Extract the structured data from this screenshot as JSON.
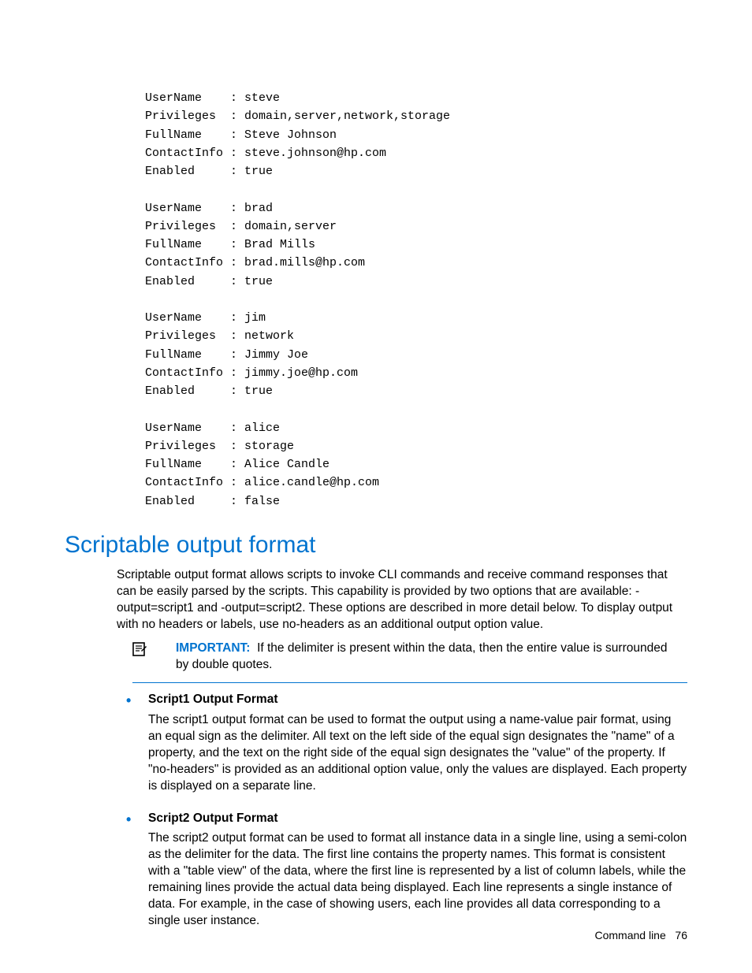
{
  "users": [
    {
      "UserName": "steve",
      "Privileges": "domain,server,network,storage",
      "FullName": "Steve Johnson",
      "ContactInfo": "steve.johnson@hp.com",
      "Enabled": "true"
    },
    {
      "UserName": "brad",
      "Privileges": "domain,server",
      "FullName": "Brad Mills",
      "ContactInfo": "brad.mills@hp.com",
      "Enabled": "true"
    },
    {
      "UserName": "jim",
      "Privileges": "network",
      "FullName": "Jimmy Joe",
      "ContactInfo": "jimmy.joe@hp.com",
      "Enabled": "true"
    },
    {
      "UserName": "alice",
      "Privileges": "storage",
      "FullName": "Alice Candle",
      "ContactInfo": "alice.candle@hp.com",
      "Enabled": "false"
    }
  ],
  "heading": "Scriptable output format",
  "intro": "Scriptable output format allows scripts to invoke CLI commands and receive command responses that can be easily parsed by the scripts. This capability is provided by two options that are available: -output=script1 and -output=script2. These options are described in more detail below. To display output with no headers or labels, use no-headers as an additional output option value.",
  "note_label": "IMPORTANT:",
  "note_text": "If the delimiter is present within the data, then the entire value is surrounded by double quotes.",
  "bullets": [
    {
      "title": "Script1 Output Format",
      "body": "The script1 output format can be used to format the output using a name-value pair format, using an equal sign as the delimiter. All text on the left side of the equal sign designates the \"name\" of a property, and the text on the right side of the equal sign designates the \"value\" of the property. If \"no-headers\" is provided as an additional option value, only the values are displayed. Each property is displayed on a separate line."
    },
    {
      "title": "Script2 Output Format",
      "body": "The script2 output format can be used to format all instance data in a single line, using a semi-colon as the delimiter for the data. The first line contains the property names. This format is consistent with a \"table view\" of the data, where the first line is represented by a list of column labels, while the remaining lines provide the actual data being displayed. Each line represents a single instance of data. For example, in the case of showing users, each line provides all data corresponding to a single user instance."
    }
  ],
  "footer_section": "Command line",
  "footer_page": "76"
}
